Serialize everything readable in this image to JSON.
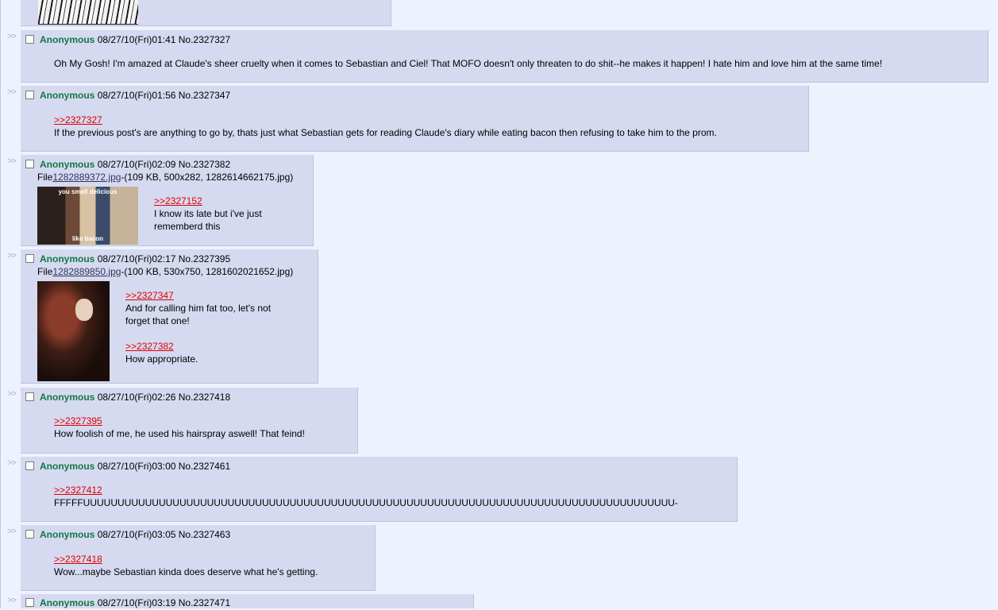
{
  "posts": [
    {
      "name": "Anonymous",
      "meta": "08/27/10(Fri)01:41 No.2327327",
      "lines": [
        "Oh My Gosh! I'm amazed at Claude's sheer cruelty when it comes to Sebastian and Ciel! That MOFO doesn't only threaten to do shit--he makes it happen! I hate him and love him at the same time!"
      ]
    },
    {
      "name": "Anonymous",
      "meta": "08/27/10(Fri)01:56 No.2327347",
      "quote": ">>2327327",
      "lines": [
        "If the previous post's are anything to go by, thats just what Sebastian gets for reading Claude's diary while eating bacon then refusing to take him to the prom."
      ]
    },
    {
      "name": "Anonymous",
      "meta": "08/27/10(Fri)02:09 No.2327382",
      "file_prefix": "File",
      "file_link": "1282889372.jpg",
      "file_info": "-(109 KB, 500x282, 1282614662175.jpg)",
      "thumb_top_text": "you smell delicious",
      "thumb_bottom_text": "like bacon",
      "quote": ">>2327152",
      "lines": [
        "I know its late but i've just",
        "rememberd this"
      ]
    },
    {
      "name": "Anonymous",
      "meta": "08/27/10(Fri)02:17 No.2327395",
      "file_prefix": "File",
      "file_link": "1282889850.jpg",
      "file_info": "-(100 KB, 530x750, 1281602021652.jpg)",
      "quote": ">>2327347",
      "lines": [
        "And for calling him fat too, let's not",
        "forget that one!"
      ],
      "quote2": ">>2327382",
      "lines2": [
        "How appropriate."
      ]
    },
    {
      "name": "Anonymous",
      "meta": "08/27/10(Fri)02:26 No.2327418",
      "quote": ">>2327395",
      "lines": [
        "How foolish of me, he used his hairspray aswell! That feind!"
      ]
    },
    {
      "name": "Anonymous",
      "meta": "08/27/10(Fri)03:00 No.2327461",
      "quote": ">>2327412",
      "lines": [
        "FFFFFUUUUUUUUUUUUUUUUUUUUUUUUUUUUUUUUUUUUUUUUUUUUUUUUUUUUUUUUUUUUUUUUUUUUUUUUUUUUUUUUUUUUUU-"
      ]
    },
    {
      "name": "Anonymous",
      "meta": "08/27/10(Fri)03:05 No.2327463",
      "quote": ">>2327418",
      "lines": [
        "Wow...maybe Sebastian kinda does deserve what he's getting."
      ]
    },
    {
      "name": "Anonymous",
      "meta": "08/27/10(Fri)03:19 No.2327471"
    }
  ],
  "reply_arrows": ">>"
}
